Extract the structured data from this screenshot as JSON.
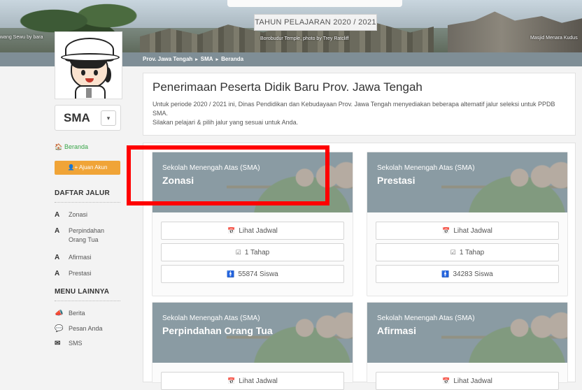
{
  "banner": {
    "year_label": "TAHUN PELAJARAN 2020 / 2021",
    "caption_left": "wang Sewu by bara",
    "caption_mid": "Borobudur Temple, photo by Trey Ratcliff",
    "caption_right": "Masjid Menara Kudus"
  },
  "breadcrumb": {
    "items": [
      "Prov. Jawa Tengah",
      "SMA",
      "Beranda"
    ],
    "separator": "▸"
  },
  "sidebar": {
    "level": "SMA",
    "level_dropdown_glyph": "▾",
    "beranda_label": "Beranda",
    "ajuan_label": "Ajuan Akun",
    "daftar_jalur_title": "DAFTAR JALUR",
    "jalur": [
      {
        "label": "Zonasi"
      },
      {
        "label": "Perpindahan Orang Tua"
      },
      {
        "label": "Afirmasi"
      },
      {
        "label": "Prestasi"
      }
    ],
    "menu_lainnya_title": "MENU LAINNYA",
    "menu": [
      {
        "label": "Berita",
        "icon": "megaphone-icon"
      },
      {
        "label": "Pesan Anda",
        "icon": "chat-icon"
      },
      {
        "label": "SMS",
        "icon": "envelope-icon"
      }
    ]
  },
  "intro": {
    "title": "Penerimaan Peserta Didik Baru Prov. Jawa Tengah",
    "paragraph1": "Untuk periode 2020 / 2021 ini, Dinas Pendidikan dan Kebudayaan Prov. Jawa Tengah menyediakan beberapa altematif jalur seleksi untuk PPDB SMA.",
    "paragraph2": "Silakan pelajari & pilih jalur yang sesuai untuk Anda."
  },
  "cards": [
    {
      "subtitle": "Sekolah Menengah Atas (SMA)",
      "title": "Zonasi",
      "jadwal": "Lihat Jadwal",
      "tahap": "1 Tahap",
      "siswa": "55874 Siswa"
    },
    {
      "subtitle": "Sekolah Menengah Atas (SMA)",
      "title": "Prestasi",
      "jadwal": "Lihat Jadwal",
      "tahap": "1 Tahap",
      "siswa": "34283 Siswa"
    },
    {
      "subtitle": "Sekolah Menengah Atas (SMA)",
      "title": "Perpindahan Orang Tua",
      "jadwal": "Lihat Jadwal"
    },
    {
      "subtitle": "Sekolah Menengah Atas (SMA)",
      "title": "Afirmasi",
      "jadwal": "Lihat Jadwal"
    }
  ],
  "colors": {
    "accent_orange": "#f0a437",
    "accent_green": "#3aa64a",
    "highlight_red": "#ff0000",
    "card_header": "#8a9ba3"
  }
}
